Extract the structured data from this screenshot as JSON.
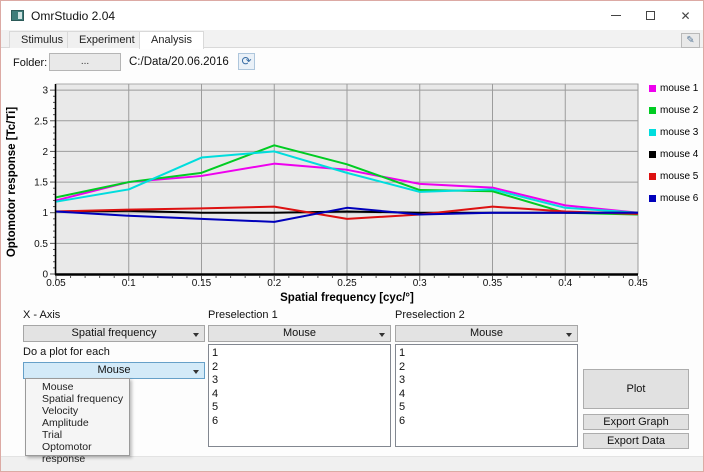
{
  "window": {
    "title": "OmrStudio 2.04",
    "minimize_glyph": "",
    "close_glyph": "✕"
  },
  "tabs": [
    {
      "label": "Stimulus"
    },
    {
      "label": "Experiment"
    },
    {
      "label": "Analysis"
    }
  ],
  "icons": {
    "refresh": "⟳",
    "tools": "✎"
  },
  "folder": {
    "label": "Folder:",
    "browse_label": "...",
    "path": "C:/Data/20.06.2016"
  },
  "chart_data": {
    "type": "line",
    "title": "",
    "xlabel": "Spatial frequency [cyc/°]",
    "ylabel": "Optomotor response [Tc/Ti]",
    "xlim": [
      0.05,
      0.45
    ],
    "ylim": [
      0,
      3.1
    ],
    "grid": true,
    "legend_position": "right",
    "xtick_values": [
      0.05,
      0.1,
      0.15,
      0.2,
      0.25,
      0.3,
      0.35,
      0.4,
      0.45
    ],
    "xtick_labels": [
      "0.05",
      "0.1",
      "0.15",
      "0.2",
      "0.25",
      "0.3",
      "0.35",
      "0.4",
      "0.45"
    ],
    "ytick_values": [
      0,
      0.5,
      1,
      1.5,
      2,
      2.5,
      3
    ],
    "ytick_labels": [
      "0",
      "0.5",
      "1",
      "1.5",
      "2",
      "2.5",
      "3"
    ],
    "x": [
      0.05,
      0.1,
      0.15,
      0.2,
      0.25,
      0.3,
      0.35,
      0.4,
      0.45
    ],
    "series": [
      {
        "name": "mouse 1",
        "color": "#ee00ee",
        "values": [
          1.2,
          1.5,
          1.6,
          1.8,
          1.7,
          1.47,
          1.41,
          1.12,
          1.0
        ]
      },
      {
        "name": "mouse 2",
        "color": "#00cc22",
        "values": [
          1.25,
          1.5,
          1.65,
          2.1,
          1.79,
          1.37,
          1.35,
          1.0,
          0.97
        ]
      },
      {
        "name": "mouse 3",
        "color": "#00dddd",
        "values": [
          1.18,
          1.38,
          1.9,
          2.0,
          1.65,
          1.34,
          1.38,
          1.08,
          1.0
        ]
      },
      {
        "name": "mouse 4",
        "color": "#000000",
        "values": [
          1.02,
          1.03,
          1.0,
          1.0,
          1.02,
          1.0,
          1.0,
          1.0,
          1.0
        ]
      },
      {
        "name": "mouse 5",
        "color": "#dd1111",
        "values": [
          1.02,
          1.05,
          1.07,
          1.1,
          0.9,
          0.97,
          1.1,
          1.02,
          0.98
        ]
      },
      {
        "name": "mouse 6",
        "color": "#0000bb",
        "values": [
          1.02,
          0.95,
          0.9,
          0.85,
          1.08,
          0.97,
          1.0,
          1.0,
          1.0
        ]
      }
    ]
  },
  "controls": {
    "x_axis": {
      "label": "X - Axis",
      "value": "Spatial frequency"
    },
    "preselection1": {
      "label": "Preselection 1",
      "value": "Mouse",
      "items": [
        "1",
        "2",
        "3",
        "4",
        "5",
        "6"
      ]
    },
    "preselection2": {
      "label": "Preselection 2",
      "value": "Mouse",
      "items": [
        "1",
        "2",
        "3",
        "4",
        "5",
        "6"
      ]
    },
    "plot_for_each": {
      "label": "Do a plot for each",
      "value": "Mouse",
      "options": [
        "Mouse",
        "Spatial frequency",
        "Velocity",
        "Amplitude",
        "Trial",
        "Optomotor response"
      ]
    },
    "buttons": {
      "plot": "Plot",
      "export_graph": "Export Graph",
      "export_data": "Export Data"
    }
  }
}
